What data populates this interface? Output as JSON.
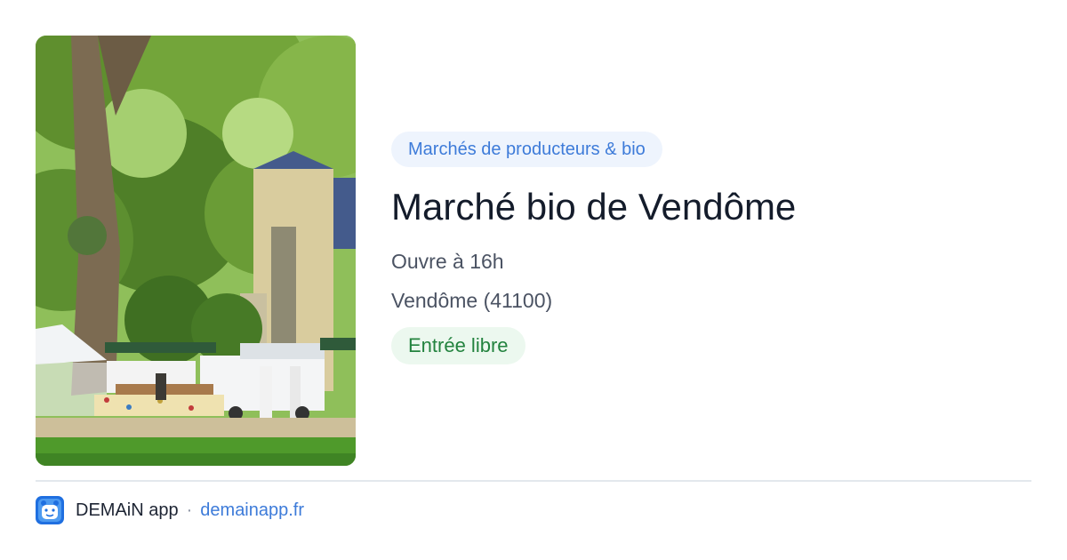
{
  "image": {
    "subject": "market-photo",
    "alt": ""
  },
  "category": {
    "label": "Marchés de producteurs & bio"
  },
  "event": {
    "title": "Marché bio de Vendôme",
    "hours": "Ouvre à 16h",
    "location": "Vendôme (41100)",
    "access": "Entrée libre"
  },
  "footer": {
    "app_name": "DEMAiN app",
    "separator": "·",
    "site": "demainapp.fr"
  },
  "colors": {
    "accent_blue": "#3d7bd9",
    "pill_blue_bg": "#eef4fd",
    "access_green": "#23833f",
    "pill_green_bg": "#ecf8ef",
    "title_text": "#141c2b",
    "secondary_text": "#4b5363"
  },
  "icons": {
    "app": "demain-app-icon"
  }
}
